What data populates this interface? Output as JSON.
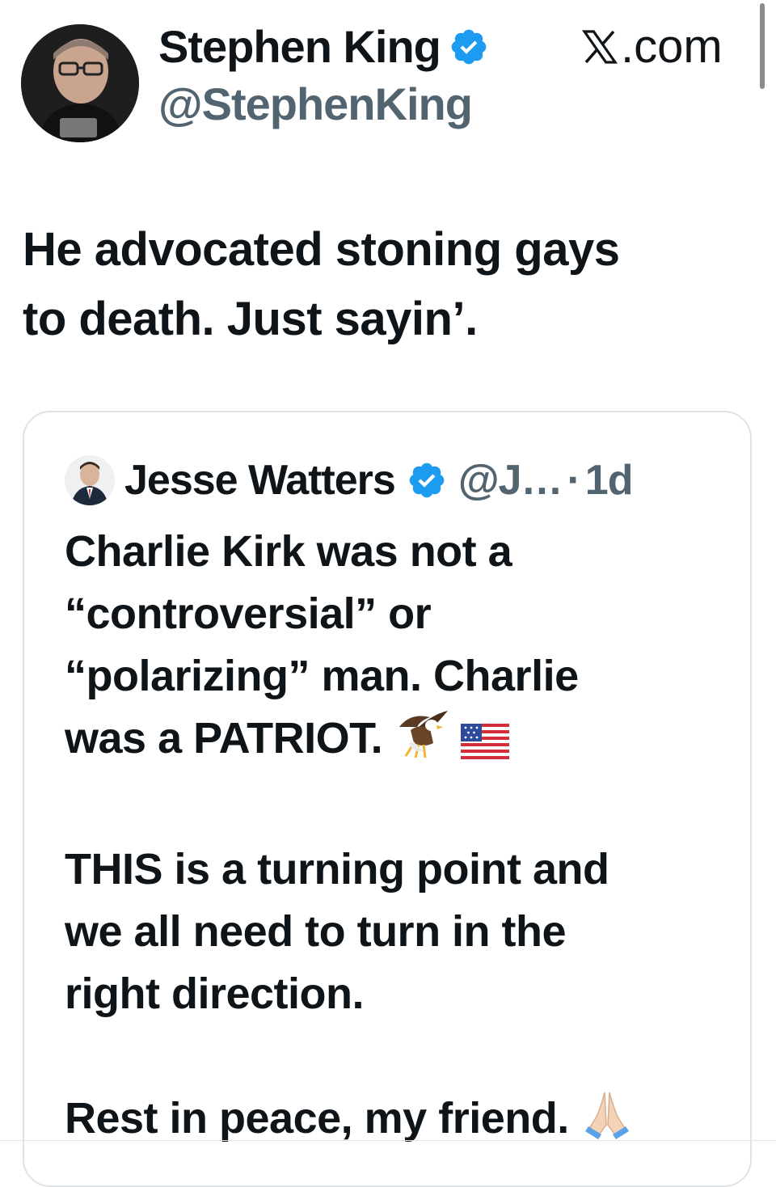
{
  "header": {
    "author_name": "Stephen King",
    "author_handle": "@StephenKing",
    "site_label": ".com",
    "verified_icon": "verified-badge-icon",
    "verified_color": "#1d9bf0"
  },
  "tweet": {
    "line1": "He advocated stoning gays",
    "line2": "to death. Just sayin’."
  },
  "quote": {
    "author_name": "Jesse Watters",
    "author_handle": "@J…",
    "separator": "·",
    "time": "1d",
    "p1_l1": "Charlie Kirk was not a",
    "p1_l2": "“controversial” or",
    "p1_l3": "“polarizing” man. Charlie",
    "p1_l4": "was a PATRIOT.",
    "p2_l1": "THIS is a turning point and",
    "p2_l2": "we all need to turn in the",
    "p2_l3": "right direction.",
    "p3_l1": "Rest in peace, my friend.",
    "emojis": [
      "eagle",
      "us-flag",
      "folded-hands"
    ]
  },
  "colors": {
    "text": "#0f1419",
    "secondary": "#536471",
    "border": "#dfe3e6",
    "verified": "#1d9bf0"
  }
}
